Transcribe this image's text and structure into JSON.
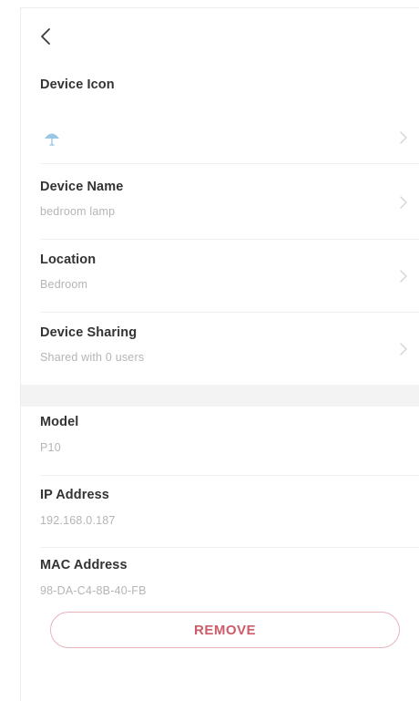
{
  "header": {
    "back_icon": "chevron-left-icon"
  },
  "device_icon": {
    "label": "Device Icon",
    "icon": "lamp-icon",
    "icon_color": "#9cc6e6"
  },
  "settings": [
    {
      "key": "name",
      "label": "Device Name",
      "value": "bedroom lamp"
    },
    {
      "key": "location",
      "label": "Location",
      "value": "Bedroom"
    },
    {
      "key": "sharing",
      "label": "Device Sharing",
      "value": "Shared with 0 users"
    }
  ],
  "info": [
    {
      "key": "model",
      "label": "Model",
      "value": "P10"
    },
    {
      "key": "ip",
      "label": "IP Address",
      "value": "192.168.0.187"
    },
    {
      "key": "mac",
      "label": "MAC Address",
      "value": "98-DA-C4-8B-40-FB"
    }
  ],
  "actions": {
    "remove_label": "REMOVE",
    "remove_color": "#cf5a6a"
  }
}
